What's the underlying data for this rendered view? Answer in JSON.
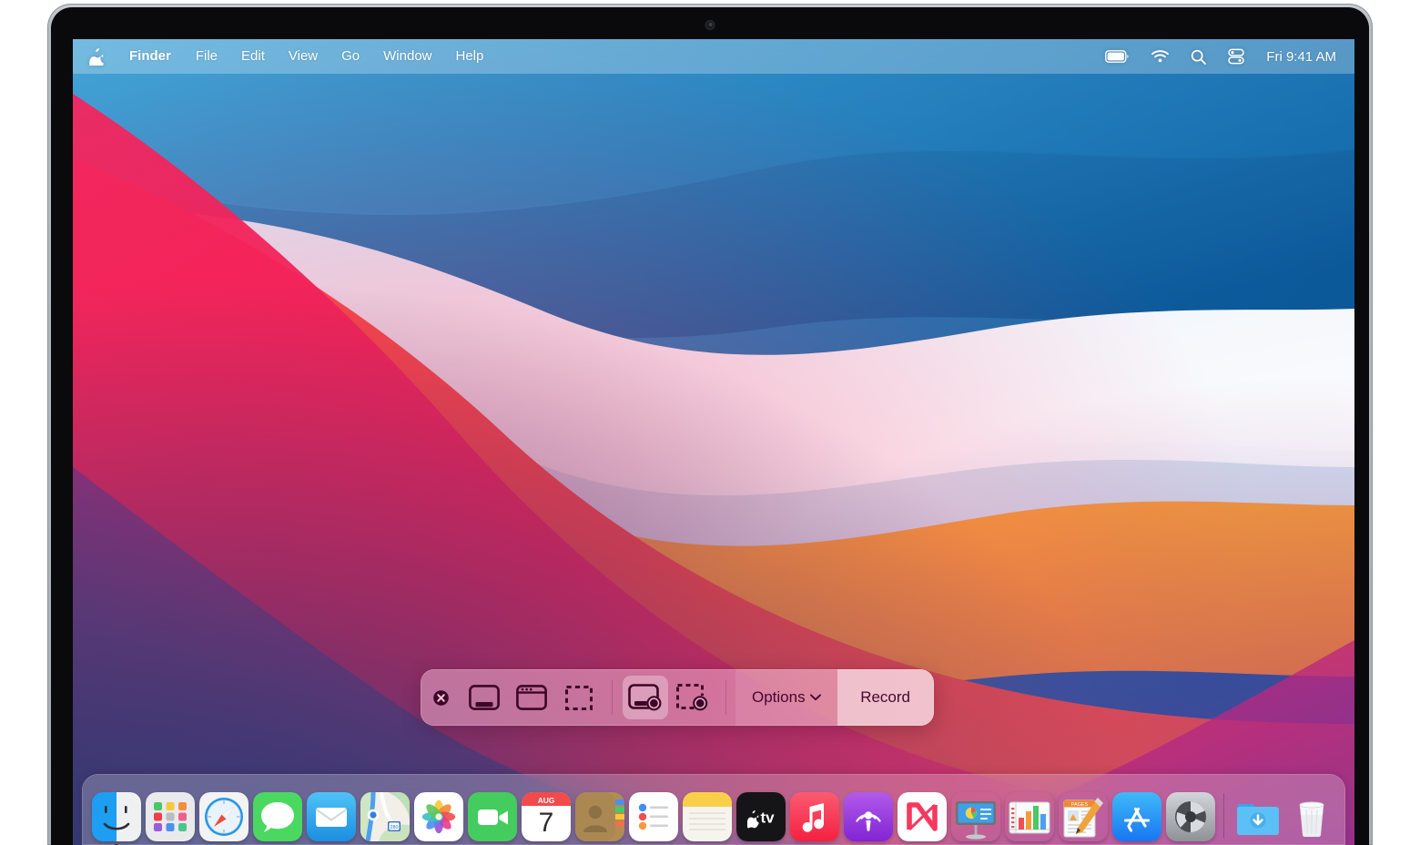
{
  "menubar": {
    "apple_logo": "apple-logo",
    "app_name": "Finder",
    "menus": [
      "File",
      "Edit",
      "View",
      "Go",
      "Window",
      "Help"
    ],
    "status_icons": [
      "battery-icon",
      "wifi-icon",
      "search-icon",
      "control-center-icon"
    ],
    "clock": "Fri 9:41 AM"
  },
  "screenshot_toolbar": {
    "close_label": "close-icon",
    "buttons": [
      {
        "name": "capture-entire-screen",
        "label": "Capture Entire Screen",
        "selected": false
      },
      {
        "name": "capture-selected-window",
        "label": "Capture Selected Window",
        "selected": false
      },
      {
        "name": "capture-selected-portion",
        "label": "Capture Selected Portion",
        "selected": false
      },
      {
        "name": "record-entire-screen",
        "label": "Record Entire Screen",
        "selected": true
      },
      {
        "name": "record-selected-portion",
        "label": "Record Selected Portion",
        "selected": false
      }
    ],
    "options_label": "Options",
    "record_label": "Record",
    "accent_color": "#f5a8cf",
    "icon_color": "#3d0626"
  },
  "dock": {
    "items": [
      {
        "name": "finder",
        "label": "Finder",
        "running": true
      },
      {
        "name": "launchpad",
        "label": "Launchpad",
        "running": false
      },
      {
        "name": "safari",
        "label": "Safari",
        "running": false
      },
      {
        "name": "messages",
        "label": "Messages",
        "running": false
      },
      {
        "name": "mail",
        "label": "Mail",
        "running": false
      },
      {
        "name": "maps",
        "label": "Maps",
        "running": false
      },
      {
        "name": "photos",
        "label": "Photos",
        "running": false
      },
      {
        "name": "facetime",
        "label": "FaceTime",
        "running": false
      },
      {
        "name": "calendar",
        "label": "Calendar",
        "running": false,
        "month": "AUG",
        "day": "7"
      },
      {
        "name": "contacts",
        "label": "Contacts",
        "running": false
      },
      {
        "name": "reminders",
        "label": "Reminders",
        "running": false
      },
      {
        "name": "notes",
        "label": "Notes",
        "running": false
      },
      {
        "name": "appletv",
        "label": "Apple TV",
        "running": false
      },
      {
        "name": "music",
        "label": "Music",
        "running": false
      },
      {
        "name": "podcasts",
        "label": "Podcasts",
        "running": false
      },
      {
        "name": "news",
        "label": "News",
        "running": false
      },
      {
        "name": "keynote",
        "label": "Keynote",
        "running": false
      },
      {
        "name": "numbers",
        "label": "Numbers",
        "running": false
      },
      {
        "name": "pages",
        "label": "Pages",
        "running": false
      },
      {
        "name": "appstore",
        "label": "App Store",
        "running": false
      },
      {
        "name": "system-preferences",
        "label": "System Preferences",
        "running": false
      },
      {
        "name": "downloads-folder",
        "label": "Downloads",
        "running": false
      },
      {
        "name": "trash",
        "label": "Trash",
        "running": false
      }
    ]
  },
  "wallpaper": {
    "name": "Big Sur",
    "colors": {
      "blue_dark": "#0f5ea8",
      "blue_mid": "#1d79b8",
      "blue_light": "#3f9fd4",
      "white_band": "#eef3fa",
      "orange": "#f8a93a",
      "red": "#f4503e",
      "pink": "#f51e5a",
      "magenta": "#c12a86",
      "purple": "#5b4municipal"
    }
  }
}
